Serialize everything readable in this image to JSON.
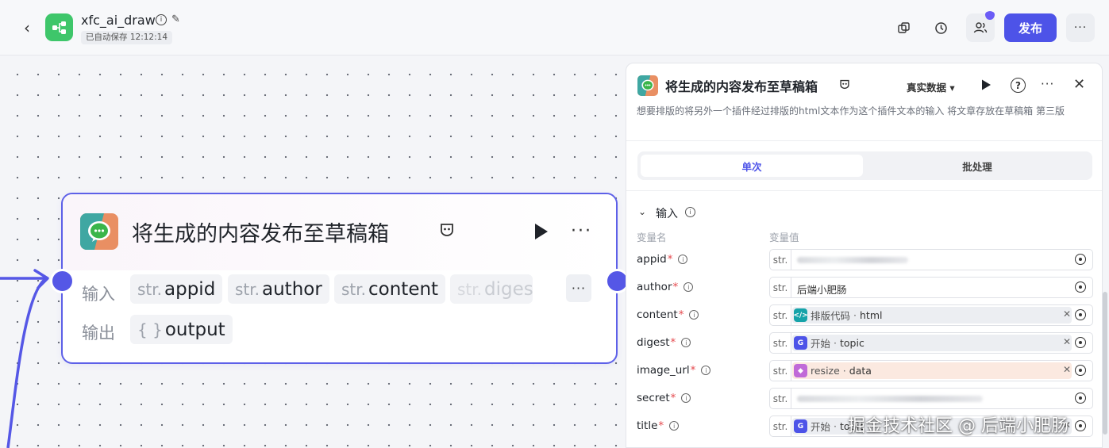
{
  "header": {
    "back_icon": "chevron-left-icon",
    "app_name": "xfc_ai_draw",
    "autosave": "已自动保存 12:12:14",
    "publish_label": "发布",
    "colors": {
      "primary": "#4d53e8",
      "app_logo": "#3ec66a"
    }
  },
  "node": {
    "title": "将生成的内容发布至草稿箱",
    "input_label": "输入",
    "output_label": "输出",
    "inputs": [
      {
        "type": "str.",
        "name": "appid"
      },
      {
        "type": "str.",
        "name": "author"
      },
      {
        "type": "str.",
        "name": "content"
      },
      {
        "type": "str.",
        "name": "digest"
      }
    ],
    "outputs": [
      {
        "type": "{ }",
        "name": "output"
      }
    ]
  },
  "panel": {
    "title": "将生成的内容发布至草稿箱",
    "mode": "真实数据",
    "description": "想要排版的将另外一个插件经过排版的html文本作为这个插件文本的输入 将文章存放在草稿箱 第三版",
    "tabs": {
      "single": "单次",
      "batch": "批处理"
    },
    "section_title": "输入",
    "col_name": "变量名",
    "col_value": "变量值",
    "params": [
      {
        "name": "appid",
        "required": "*",
        "type": "str."
      },
      {
        "name": "author",
        "required": "*",
        "type": "str.",
        "value": "后端小肥肠"
      },
      {
        "name": "content",
        "required": "*",
        "type": "str.",
        "ref_source": "排版代码",
        "ref_var": "html",
        "ref_icon": "code-icon"
      },
      {
        "name": "digest",
        "required": "*",
        "type": "str.",
        "ref_source": "开始",
        "ref_var": "topic",
        "ref_icon": "start-icon"
      },
      {
        "name": "image_url",
        "required": "*",
        "type": "str.",
        "ref_source": "resize",
        "ref_var": "data",
        "ref_icon": "cube-icon"
      },
      {
        "name": "secret",
        "required": "*",
        "type": "str."
      },
      {
        "name": "title",
        "required": "*",
        "type": "str.",
        "ref_source": "开始",
        "ref_var": "topic",
        "ref_icon": "start-icon"
      }
    ]
  },
  "watermark": "掘金技术社区 @ 后端小肥肠"
}
